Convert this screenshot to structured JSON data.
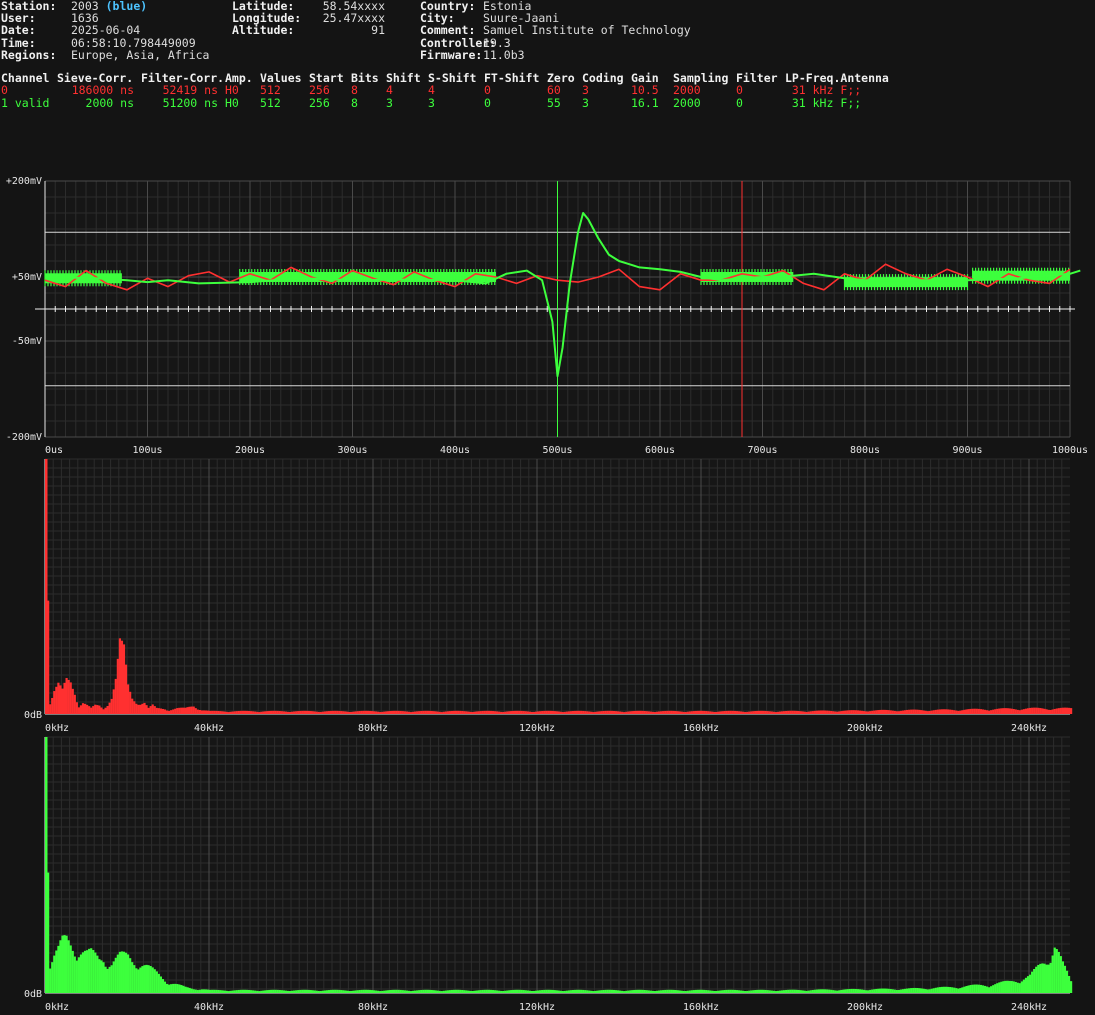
{
  "station_info": {
    "col1": [
      {
        "key": "Station:",
        "value": "2003",
        "extra": "(blue)"
      },
      {
        "key": "User:",
        "value": "1636"
      },
      {
        "key": "Date:",
        "value": "2025-06-04"
      },
      {
        "key": "Time:",
        "value": "06:58:10.798449009"
      },
      {
        "key": "Regions:",
        "value": "Europe, Asia, Africa"
      }
    ],
    "col2": [
      {
        "key": "Latitude:",
        "value": "58.54xxxx"
      },
      {
        "key": "Longitude:",
        "value": "25.47xxxx"
      },
      {
        "key": "Altitude:",
        "value": "91"
      }
    ],
    "col3": [
      {
        "key": "Country:",
        "value": "Estonia"
      },
      {
        "key": "City:",
        "value": "Suure-Jaani"
      },
      {
        "key": "Comment:",
        "value": "Samuel Institute of Technology"
      },
      {
        "key": "Controller:",
        "value": "19.3"
      },
      {
        "key": "Firmware:",
        "value": "11.0b3"
      }
    ]
  },
  "channel_table": {
    "headers": [
      "Channel",
      "Sieve-Corr.",
      "Filter-Corr.",
      "Amp.",
      "Values",
      "Start",
      "Bits",
      "Shift",
      "S-Shift",
      "FT-Shift",
      "Zero",
      "Coding",
      "Gain",
      "Sampling",
      "Filter",
      "LP-Freq.",
      "Antenna"
    ],
    "rows": [
      [
        "0",
        "186000 ns",
        "52419 ns",
        "H0",
        "512",
        "256",
        "8",
        "4",
        "4",
        "0",
        "60",
        "3",
        "10.5",
        "2000",
        "0",
        "31 kHz",
        "F;;"
      ],
      [
        "1 valid",
        "2000 ns",
        "51200 ns",
        "H0",
        "512",
        "256",
        "8",
        "3",
        "3",
        "0",
        "55",
        "3",
        "16.1",
        "2000",
        "0",
        "31 kHz",
        "F;;"
      ]
    ],
    "colors": [
      "#ff3030",
      "#3dff3d"
    ]
  },
  "chart_data": [
    {
      "type": "line",
      "x_ticks": [
        "0us",
        "100us",
        "200us",
        "300us",
        "400us",
        "500us",
        "600us",
        "700us",
        "800us",
        "900us",
        "1000us"
      ],
      "y_ticks": [
        "+200mV",
        "+50mV",
        "-50mV",
        "-200mV"
      ],
      "xlim": [
        0,
        1000
      ],
      "ylim": [
        -200,
        200
      ],
      "markers_us": [
        {
          "x": 500,
          "color": "#3dff3d"
        },
        {
          "x": 680,
          "color": "#ff3030"
        }
      ],
      "reference_lines_mV": [
        120,
        -120
      ],
      "zero_line_mV": 0,
      "series": [
        {
          "color": "#ff3030",
          "x": [
            0,
            20,
            40,
            60,
            80,
            100,
            120,
            140,
            160,
            180,
            200,
            220,
            240,
            260,
            280,
            300,
            320,
            340,
            360,
            380,
            400,
            420,
            440,
            460,
            480,
            500,
            520,
            540,
            560,
            580,
            600,
            620,
            640,
            660,
            680,
            700,
            720,
            740,
            760,
            780,
            800,
            820,
            840,
            860,
            880,
            900,
            920,
            940,
            960,
            980,
            1000
          ],
          "y": [
            45,
            35,
            60,
            40,
            30,
            48,
            35,
            52,
            58,
            42,
            55,
            45,
            65,
            50,
            40,
            60,
            48,
            38,
            58,
            45,
            35,
            55,
            50,
            40,
            52,
            45,
            42,
            50,
            62,
            35,
            30,
            55,
            45,
            45,
            55,
            50,
            60,
            40,
            30,
            55,
            45,
            70,
            55,
            45,
            62,
            50,
            35,
            55,
            45,
            40,
            62
          ]
        },
        {
          "color": "#3dff3d",
          "x": [
            0,
            50,
            80,
            100,
            120,
            150,
            200,
            250,
            300,
            350,
            400,
            430,
            450,
            470,
            485,
            495,
            500,
            505,
            512,
            520,
            525,
            530,
            540,
            550,
            560,
            570,
            580,
            600,
            620,
            640,
            660,
            680,
            700,
            730,
            750,
            780,
            800,
            850,
            900,
            950,
            1000,
            1010
          ],
          "y": [
            50,
            48,
            45,
            42,
            45,
            40,
            42,
            48,
            45,
            46,
            45,
            40,
            55,
            60,
            45,
            -20,
            -105,
            -60,
            40,
            120,
            150,
            140,
            110,
            85,
            75,
            70,
            65,
            62,
            58,
            50,
            45,
            48,
            50,
            52,
            55,
            48,
            45,
            45,
            45,
            48,
            55,
            60
          ]
        }
      ],
      "pulse_blocks": [
        {
          "start_us": 0,
          "end_us": 75,
          "y_mV": 48,
          "channel": 1
        },
        {
          "start_us": 190,
          "end_us": 440,
          "y_mV": 50,
          "channel": 1
        },
        {
          "start_us": 640,
          "end_us": 730,
          "y_mV": 50,
          "channel": 1
        },
        {
          "start_us": 780,
          "end_us": 900,
          "y_mV": 42,
          "channel": 1
        },
        {
          "start_us": 905,
          "end_us": 1000,
          "y_mV": 52,
          "channel": 1
        }
      ]
    },
    {
      "type": "bar",
      "color": "#ff3030",
      "x_ticks": [
        "0kHz",
        "40kHz",
        "80kHz",
        "120kHz",
        "160kHz",
        "200kHz",
        "240kHz"
      ],
      "y_ticks": [
        "0dB"
      ],
      "xlim": [
        0,
        250
      ],
      "sample_points": [
        [
          0,
          100
        ],
        [
          1,
          4
        ],
        [
          2,
          8
        ],
        [
          3,
          10
        ],
        [
          4,
          8
        ],
        [
          5,
          12
        ],
        [
          6,
          12
        ],
        [
          7,
          9
        ],
        [
          8,
          3
        ],
        [
          9,
          4
        ],
        [
          10,
          3
        ],
        [
          11,
          2
        ],
        [
          12,
          3
        ],
        [
          13,
          3
        ],
        [
          14,
          2
        ],
        [
          15,
          4
        ],
        [
          16,
          6
        ],
        [
          17,
          12
        ],
        [
          18,
          24
        ],
        [
          19,
          22
        ],
        [
          20,
          10
        ],
        [
          21,
          6
        ],
        [
          22,
          5
        ],
        [
          23,
          4
        ],
        [
          24,
          4
        ],
        [
          25,
          2
        ],
        [
          26,
          3
        ],
        [
          27,
          2
        ],
        [
          28,
          2
        ],
        [
          29,
          2
        ],
        [
          30,
          1.5
        ],
        [
          32,
          2
        ],
        [
          34,
          2
        ],
        [
          36,
          3
        ],
        [
          38,
          1.5
        ],
        [
          40,
          1
        ],
        [
          60,
          1
        ],
        [
          100,
          1
        ],
        [
          140,
          1
        ],
        [
          180,
          1
        ],
        [
          220,
          1.5
        ],
        [
          240,
          2
        ],
        [
          245,
          2
        ],
        [
          250,
          2
        ]
      ]
    },
    {
      "type": "bar",
      "color": "#3dff3d",
      "x_ticks": [
        "0kHz",
        "40kHz",
        "80kHz",
        "120kHz",
        "160kHz",
        "200kHz",
        "240kHz"
      ],
      "y_ticks": [
        "0dB"
      ],
      "xlim": [
        0,
        250
      ],
      "sample_points": [
        [
          0,
          100
        ],
        [
          1,
          10
        ],
        [
          2,
          13
        ],
        [
          3,
          15
        ],
        [
          4,
          18
        ],
        [
          5,
          19
        ],
        [
          6,
          18
        ],
        [
          7,
          17
        ],
        [
          8,
          16
        ],
        [
          9,
          15
        ],
        [
          10,
          14
        ],
        [
          11,
          14
        ],
        [
          12,
          13
        ],
        [
          13,
          12
        ],
        [
          14,
          13
        ],
        [
          15,
          12
        ],
        [
          16,
          11
        ],
        [
          17,
          12
        ],
        [
          18,
          13
        ],
        [
          19,
          13
        ],
        [
          20,
          13
        ],
        [
          21,
          12
        ],
        [
          22,
          12
        ],
        [
          23,
          11
        ],
        [
          24,
          10
        ],
        [
          25,
          9
        ],
        [
          26,
          8
        ],
        [
          27,
          7
        ],
        [
          28,
          6
        ],
        [
          29,
          5
        ],
        [
          30,
          4
        ],
        [
          32,
          3
        ],
        [
          34,
          2
        ],
        [
          36,
          1.5
        ],
        [
          38,
          1.5
        ],
        [
          40,
          1
        ],
        [
          60,
          1
        ],
        [
          100,
          1
        ],
        [
          140,
          1
        ],
        [
          180,
          1
        ],
        [
          210,
          1.5
        ],
        [
          220,
          2
        ],
        [
          230,
          3
        ],
        [
          235,
          4
        ],
        [
          240,
          6
        ],
        [
          242,
          9
        ],
        [
          244,
          12
        ],
        [
          246,
          18
        ],
        [
          248,
          10
        ],
        [
          250,
          4
        ]
      ]
    }
  ]
}
